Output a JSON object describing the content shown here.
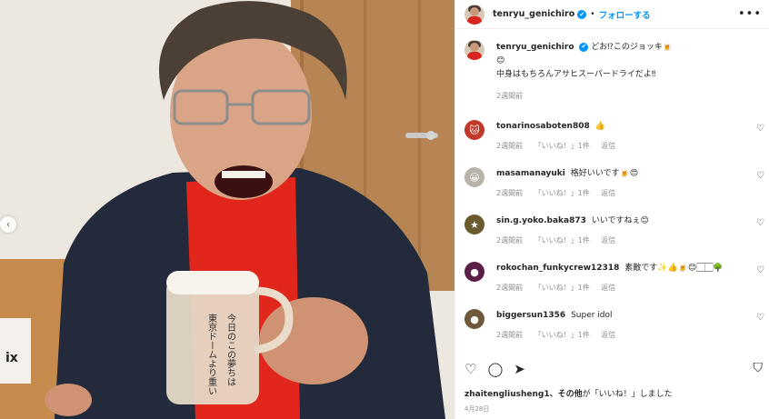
{
  "header": {
    "username": "tenryu_genichiro",
    "verified_icon": "✔",
    "separator": "•",
    "follow_label": "フォローする",
    "more_label": "•••"
  },
  "photo": {
    "carousel_prev_icon": "‹",
    "mug_text_lines": [
      "今日のこの夢ちは",
      "東京ドームより重い"
    ],
    "box_text": "ix"
  },
  "caption": {
    "username": "tenryu_genichiro",
    "line1": "どお⁉このジョッキ🍺",
    "line2": "😊",
    "line3": "中身はもちろんアサヒスーパードライだよ‼",
    "time": "2週間前"
  },
  "comments": [
    {
      "username": "tonarinosaboten808",
      "text": "👍",
      "time": "2週間前",
      "likes": "「いいね！」1件",
      "reply": "返信",
      "avatar_color": "#c0392b",
      "avatar_glyph": "🐱"
    },
    {
      "username": "masamanayuki",
      "text": "格好いいです🍺😍",
      "time": "2週間前",
      "likes": "「いいね！」1件",
      "reply": "返信",
      "avatar_color": "#b9b2a8",
      "avatar_glyph": "😀"
    },
    {
      "username": "sin.g.yoko.baka873",
      "text": "いいですねぇ😊",
      "time": "2週間前",
      "likes": "「いいね！」1件",
      "reply": "返信",
      "avatar_color": "#6b5a2e",
      "avatar_glyph": "★"
    },
    {
      "username": "rokochan_funkycrew12318",
      "text": "素敵です✨👍🍺😊🏻🏻🌳",
      "time": "2週間前",
      "likes": "「いいね！」1件",
      "reply": "返信",
      "avatar_color": "#5b1f47",
      "avatar_glyph": "●"
    },
    {
      "username": "biggersun1356",
      "text": "Super idol",
      "time": "2週間前",
      "likes": "「いいね！」1件",
      "reply": "返信",
      "avatar_color": "#6e5a3a",
      "avatar_glyph": "●"
    }
  ],
  "heart_icon": "♡",
  "actions": {
    "like_icon": "♡",
    "comment_icon": "◯",
    "share_icon": "➤",
    "save_icon": "⛉"
  },
  "likes_text": {
    "users": "zhaitengliusheng1、その他",
    "suffix": "が「いいね！」しました"
  },
  "date": "4月28日"
}
